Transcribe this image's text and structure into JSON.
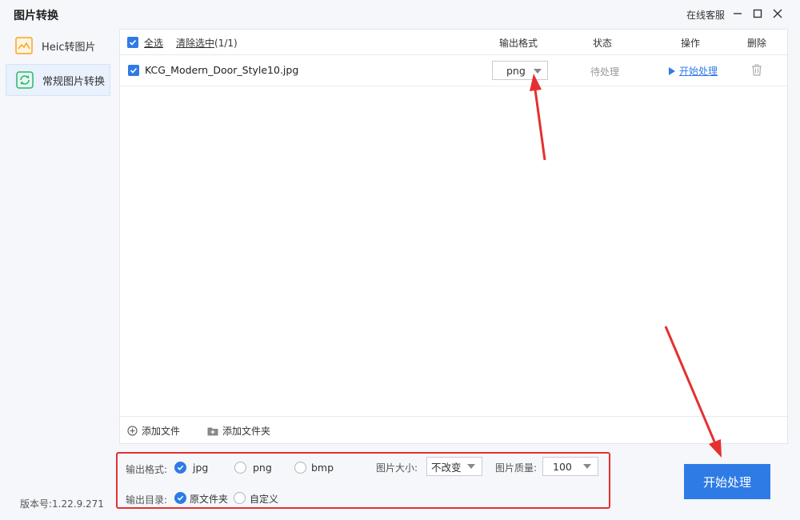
{
  "window": {
    "title": "图片转换",
    "online_service": "在线客服"
  },
  "sidebar": {
    "items": [
      {
        "label": "Heic转图片",
        "icon": "heic-image-icon",
        "active": false
      },
      {
        "label": "常规图片转换",
        "icon": "convert-refresh-icon",
        "active": true
      }
    ],
    "version": "版本号:1.22.9.271"
  },
  "table": {
    "select_all": "全选",
    "clear_selected": "清除选中",
    "selected_count": "(1/1)",
    "columns": {
      "format": "输出格式",
      "status": "状态",
      "action": "操作",
      "delete": "删除"
    },
    "rows": [
      {
        "checked": true,
        "filename": "KCG_Modern_Door_Style10.jpg",
        "format": "png",
        "status": "待处理",
        "action": "开始处理"
      }
    ]
  },
  "footer": {
    "add_file": "添加文件",
    "add_folder": "添加文件夹"
  },
  "settings": {
    "format_label": "输出格式:",
    "formats": [
      "jpg",
      "png",
      "bmp"
    ],
    "selected_format": "jpg",
    "size_label": "图片大小:",
    "size_value": "不改变",
    "quality_label": "图片质量:",
    "quality_value": "100",
    "output_dir_label": "输出目录:",
    "output_dir_options": [
      "原文件夹",
      "自定义"
    ],
    "selected_output_dir": "原文件夹"
  },
  "start_button": "开始处理",
  "colors": {
    "accent": "#2f7be5",
    "annotation_red": "#e53030",
    "heic_icon": "#f5a623",
    "convert_icon": "#2bb673"
  }
}
